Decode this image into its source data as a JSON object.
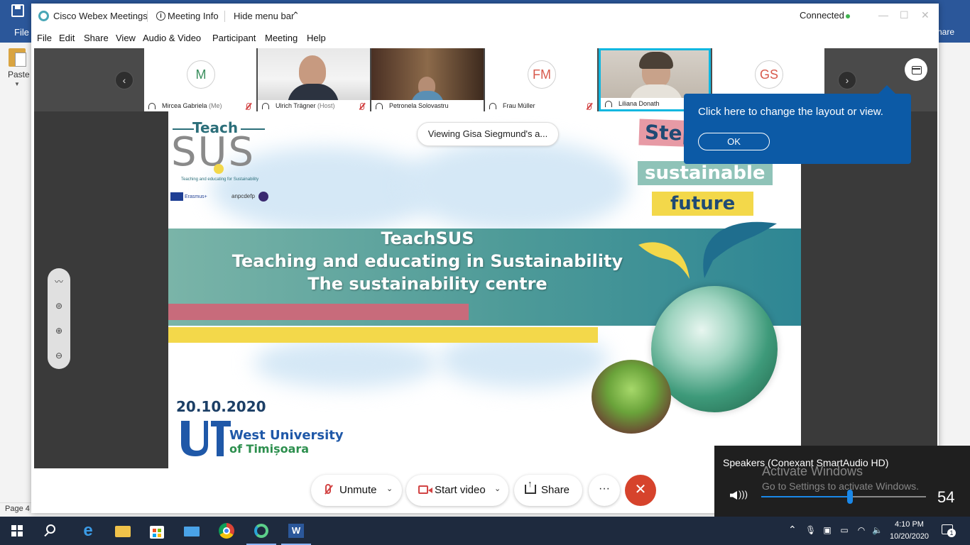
{
  "word": {
    "file_label": "File",
    "share_label": "hare",
    "paste_label": "Paste",
    "status_page": "Page 4"
  },
  "titlebar": {
    "app_title": "Cisco Webex Meetings",
    "meeting_info": "Meeting Info",
    "hide_menu": "Hide menu bar",
    "connection_status": "Connected"
  },
  "menu": [
    "File",
    "Edit",
    "Share",
    "View",
    "Audio & Video",
    "Participant",
    "Meeting",
    "Help"
  ],
  "participants": [
    {
      "initials": "M",
      "name": "Mircea Gabriela",
      "role": "(Me)",
      "muted": true,
      "video": false
    },
    {
      "initials": "",
      "name": "Ulrich Trägner",
      "role": "(Host)",
      "muted": true,
      "video": true
    },
    {
      "initials": "",
      "name": "Petronela Solovastru",
      "role": "",
      "muted": false,
      "video": true
    },
    {
      "initials": "FM",
      "name": "Frau Müller",
      "role": "",
      "muted": true,
      "video": false
    },
    {
      "initials": "",
      "name": "Liliana Donath",
      "role": "",
      "muted": false,
      "video": true,
      "active_speaker": true
    },
    {
      "initials": "GS",
      "name": "",
      "role": "",
      "muted": false,
      "video": false
    }
  ],
  "viewing_banner": "Viewing Gisa Siegmund's a...",
  "tooltip": {
    "text": "Click here to change the layout or view.",
    "ok_label": "OK"
  },
  "slide": {
    "logo_teach": "Teach",
    "logo_sus": "SUS",
    "logo_tagline": "Teaching and educating for Sustainability",
    "erasmus": "Erasmus+",
    "anpcdefp": "anpcdefp",
    "tag_step": "Step",
    "tag_sustainable": "sustainable",
    "tag_future": "future",
    "title_line1": "TeachSUS",
    "title_line2": "Teaching and educating in Sustainability",
    "title_line3": "The sustainability centre",
    "date": "20.10.2020",
    "university_line1": "West University",
    "university_line2": "of Timișoara"
  },
  "controls": {
    "unmute": "Unmute",
    "start_video": "Start video",
    "share": "Share",
    "more": "···",
    "leave": "✕"
  },
  "volume": {
    "device": "Speakers (Conexant SmartAudio HD)",
    "level": 54,
    "watermark_line1": "Activate Windows",
    "watermark_line2": "Go to Settings to activate Windows."
  },
  "taskbar": {
    "time": "4:10 PM",
    "date": "10/20/2020",
    "notification_count": "1"
  }
}
